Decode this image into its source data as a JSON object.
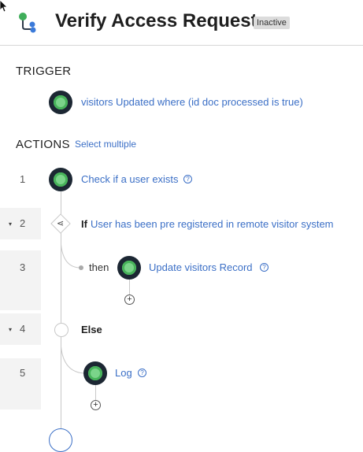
{
  "header": {
    "title": "Verify Access Request",
    "status_badge": "Inactive"
  },
  "trigger": {
    "section_label": "TRIGGER",
    "text": "visitors Updated where (id doc processed is true)"
  },
  "actions": {
    "section_label": "ACTIONS",
    "select_multiple_label": "Select multiple",
    "steps": [
      {
        "number": "1",
        "label": "Check if a user exists"
      },
      {
        "number": "2",
        "keyword": "If",
        "label": "User has been pre registered in remote visitor system"
      },
      {
        "number": "3",
        "prefix": "then",
        "label": "Update visitors Record"
      },
      {
        "number": "4",
        "keyword": "Else"
      },
      {
        "number": "5",
        "label": "Log"
      }
    ]
  },
  "icons": {
    "cursor": "mouse-pointer-icon",
    "flow": "flow-logo-icon",
    "help": "?",
    "plus": "+",
    "caret": "▾",
    "branch": "⋖"
  },
  "colors": {
    "link": "#3b6fc6",
    "node_dark": "#1c2733",
    "node_green": "#7bd48a",
    "badge_bg": "#dcdcdc"
  }
}
